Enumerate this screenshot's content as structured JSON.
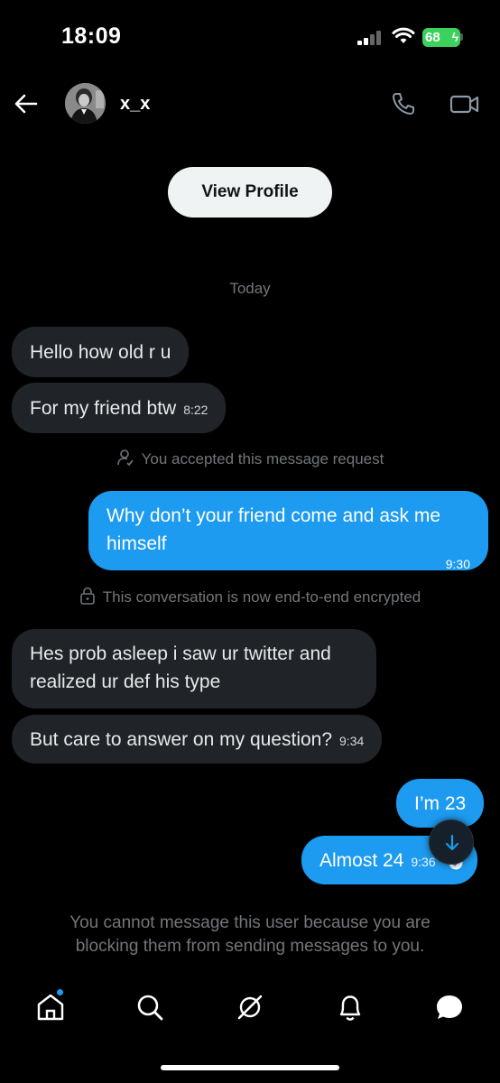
{
  "status": {
    "time": "18:09",
    "battery": "68"
  },
  "header": {
    "name": "x_x"
  },
  "profile": {
    "view_label": "View Profile"
  },
  "day_label": "Today",
  "messages": {
    "m1": {
      "text": "Hello how old r u"
    },
    "m2": {
      "text": "For my friend btw",
      "time": "8:22"
    },
    "sys1": "You accepted this message request",
    "m3": {
      "text": "Why don’t your friend come and ask me himself",
      "time": "9:30"
    },
    "sys2": "This conversation is now end-to-end encrypted",
    "m4": {
      "text": "Hes prob asleep i saw ur twitter and realized ur def his type"
    },
    "m5": {
      "text": "But care to answer on my question?",
      "time": "9:34"
    },
    "m6": {
      "text": "I’m 23"
    },
    "m7": {
      "text": "Almost 24",
      "time": "9:36"
    }
  },
  "blocked_note": "You cannot message this user because you are blocking them from sending messages to you.",
  "colors": {
    "accent": "#1d9bf0",
    "incoming": "#202327",
    "background": "#000000"
  },
  "icons": [
    "back-arrow-icon",
    "phone-icon",
    "video-icon",
    "scroll-down-icon",
    "home-icon",
    "search-icon",
    "grok-icon",
    "bell-icon",
    "messages-icon"
  ]
}
